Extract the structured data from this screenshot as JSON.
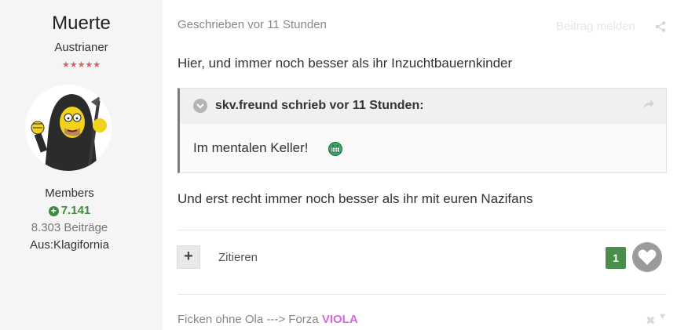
{
  "author": {
    "name": "Muerte",
    "title": "Austrianer",
    "stars": "★★★★★",
    "avatar_icon": "homer-reaper-avatar",
    "group": "Members",
    "reputation": "7.141",
    "posts": "8.303 Beiträge",
    "location": "Aus:Klagifornia"
  },
  "post": {
    "meta": "Geschrieben vor 11 Stunden",
    "report": "Beitrag melden",
    "share_icon": "share-icon",
    "paragraph1": "Hier, und immer noch besser als ihr Inzuchtbauernkinder",
    "quote": {
      "citation": "skv.freund schrieb vor 11 Stunden:",
      "text": "Im mentalen Keller!",
      "emoji": "grimace-emoji"
    },
    "paragraph2": "Und erst recht immer noch besser als ihr mit euren Nazifans"
  },
  "actions": {
    "add": "+",
    "quote_label": "Zitieren",
    "likes": "1"
  },
  "signature": {
    "text": "Ficken ohne Ola ---> Forza ",
    "highlight": "VIOLA",
    "highlight_color": "#d26adb"
  },
  "colors": {
    "sidebar_bg": "#f5f5f5",
    "reputation_green": "#3d8b3d",
    "like_green": "#4b8d4b",
    "stars_red": "#e25c5c"
  }
}
